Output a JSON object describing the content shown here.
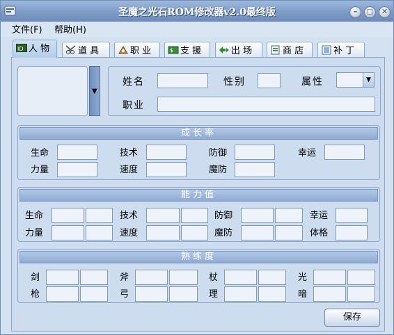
{
  "window": {
    "title": "圣魔之光石ROM修改器v2.0最终版"
  },
  "menu": [
    {
      "label": "文件(F)"
    },
    {
      "label": "帮助(H)"
    }
  ],
  "tabs": [
    {
      "label": "人 物",
      "icon": "id-card-icon"
    },
    {
      "label": "道 具",
      "icon": "scissors-icon"
    },
    {
      "label": "职 业",
      "icon": "class-icon"
    },
    {
      "label": "支 援",
      "icon": "support-icon"
    },
    {
      "label": "出 场",
      "icon": "arrows-icon"
    },
    {
      "label": "商 店",
      "icon": "shop-icon"
    },
    {
      "label": "补 丁",
      "icon": "patch-icon"
    }
  ],
  "character": {
    "name_label": "姓名",
    "gender_label": "性别",
    "attribute_label": "属性",
    "class_label": "职业",
    "name_value": "",
    "gender_value": "",
    "attribute_value": "",
    "class_value": ""
  },
  "growth": {
    "title": "成长率",
    "stats": [
      "生命",
      "技术",
      "防御",
      "幸运",
      "力量",
      "速度",
      "魔防"
    ]
  },
  "ability": {
    "title": "能力值",
    "stats": [
      "生命",
      "技术",
      "防御",
      "幸运",
      "力量",
      "速度",
      "魔防",
      "体格"
    ]
  },
  "proficiency": {
    "title": "熟练度",
    "weapons": [
      "剑",
      "斧",
      "杖",
      "光",
      "枪",
      "弓",
      "理",
      "暗"
    ]
  },
  "actions": {
    "save_label": "保存"
  }
}
